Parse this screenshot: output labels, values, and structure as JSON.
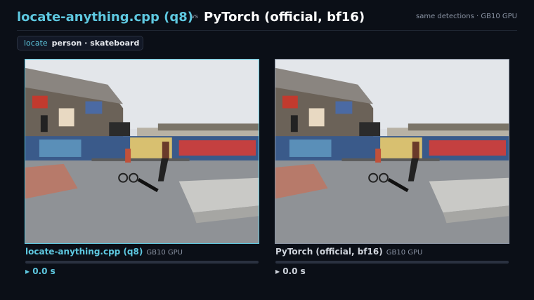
{
  "header": {
    "left_title": "locate-anything.cpp (q8)",
    "vs": "vs",
    "right_title": "PyTorch (official, bf16)",
    "meta": "same detections · GB10 GPU"
  },
  "query": {
    "label": "locate",
    "terms": "person · skateboard"
  },
  "panels": [
    {
      "name": "locate-anything.cpp (q8)",
      "gpu": "GB10 GPU",
      "time": "▸ 0.0 s",
      "progress": 0.0,
      "accent": "#5ec8e0"
    },
    {
      "name": "PyTorch (official, bf16)",
      "gpu": "GB10 GPU",
      "time": "▸ 0.0 s",
      "progress": 0.0,
      "accent": "#cfd4dc"
    }
  ],
  "colors": {
    "background": "#0b0f17",
    "accent": "#5ec8e0",
    "muted": "#8a93a3"
  }
}
